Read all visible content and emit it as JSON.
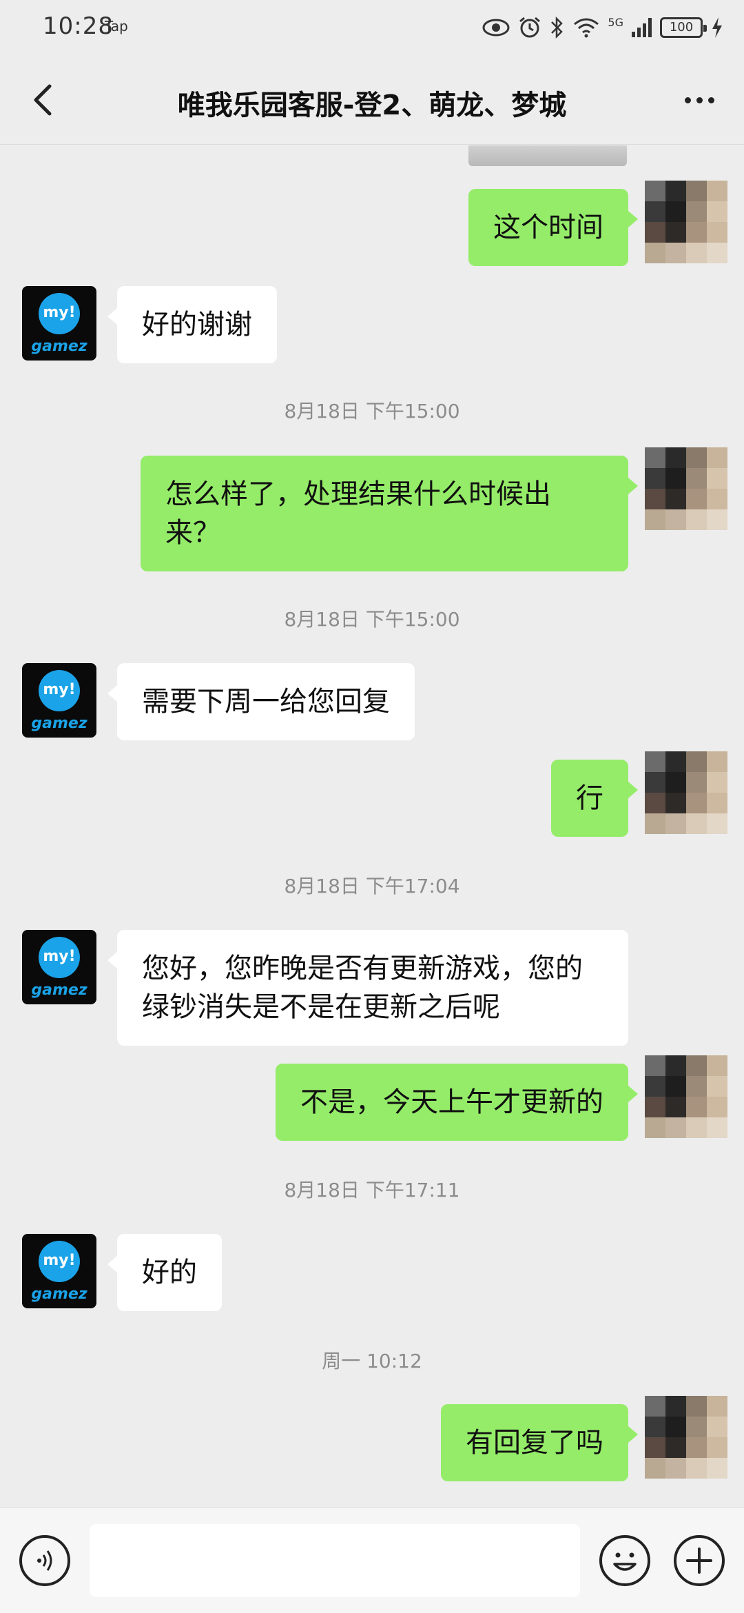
{
  "status": {
    "time": "10:28",
    "tap_label": "Tap",
    "network": "5G",
    "battery": "100"
  },
  "header": {
    "title": "唯我乐园客服-登2、萌龙、梦城"
  },
  "messages": [
    {
      "from": "me",
      "text": "这个时间"
    },
    {
      "from": "service",
      "text": "好的谢谢"
    },
    {
      "type": "time",
      "text": "8月18日 下午15:00"
    },
    {
      "from": "me",
      "text": "怎么样了，处理结果什么时候出来？"
    },
    {
      "type": "time",
      "text": "8月18日 下午15:00"
    },
    {
      "from": "service",
      "text": "需要下周一给您回复"
    },
    {
      "from": "me",
      "text": "行"
    },
    {
      "type": "time",
      "text": "8月18日 下午17:04"
    },
    {
      "from": "service",
      "text": "您好，您昨晚是否有更新游戏，您的绿钞消失是不是在更新之后呢"
    },
    {
      "from": "me",
      "text": "不是，今天上午才更新的"
    },
    {
      "type": "time",
      "text": "8月18日 下午17:11"
    },
    {
      "from": "service",
      "text": "好的"
    },
    {
      "type": "time",
      "text": "周一 10:12"
    },
    {
      "from": "me",
      "text": "有回复了吗"
    }
  ],
  "service_avatar": {
    "top_text": "my!",
    "bottom_text": "gamez"
  },
  "input": {
    "value": ""
  },
  "colors": {
    "background": "#ededed",
    "outgoing_bubble": "#95ec69",
    "incoming_bubble": "#ffffff",
    "brand_blue": "#1aa3e8"
  }
}
